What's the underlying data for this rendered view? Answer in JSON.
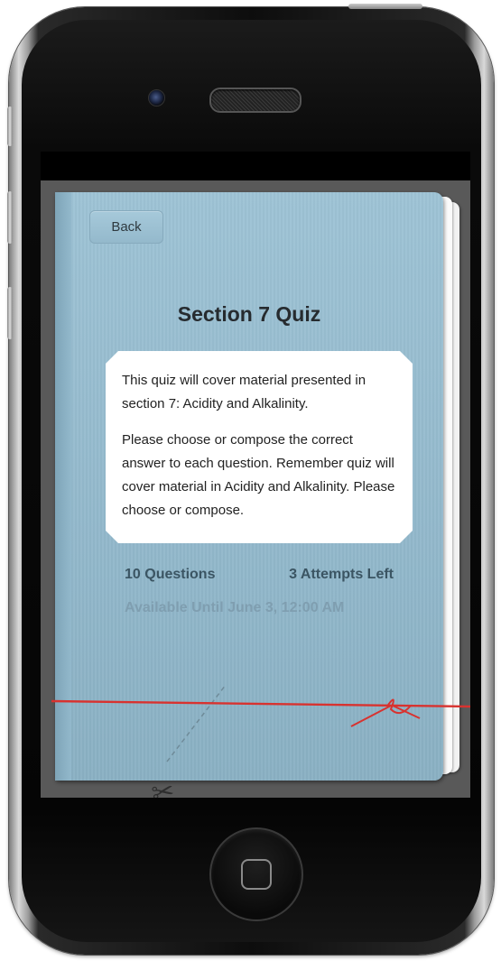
{
  "screen": {
    "back_label": "Back",
    "title": "Section 7 Quiz",
    "description": [
      "This quiz will cover material presented in section 7: Acidity and Alkalinity.",
      "Please choose or compose the correct answer to each question. Remember quiz will cover material in Acidity and Alkalinity. Please choose or compose."
    ],
    "questions": "10 Questions",
    "attempts": "3 Attempts Left",
    "availability": "Available Until June 3, 12:00 AM"
  },
  "icons": {
    "scissors": "scissors-icon",
    "home": "home-square-icon"
  },
  "colors": {
    "folder": "#9ec3d5",
    "string": "#d8322f",
    "meta_text": "#3b5563",
    "availability_text": "#7f9eb0"
  }
}
